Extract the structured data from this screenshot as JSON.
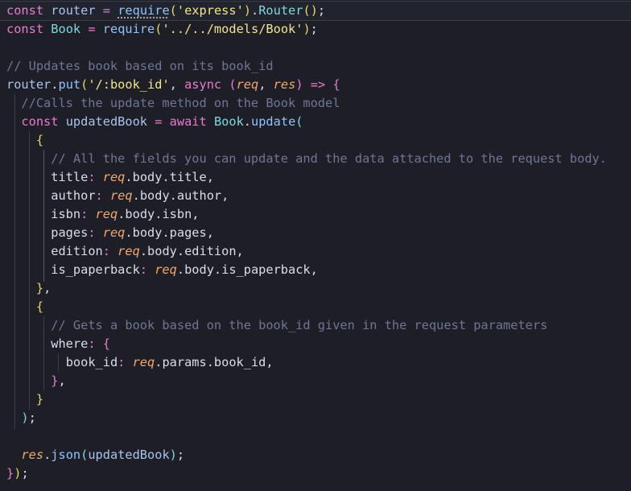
{
  "code": {
    "l1": {
      "kw": "const",
      "name": "router",
      "op": "=",
      "fn": "require",
      "p1": "(",
      "str": "'express'",
      "p2": ")",
      "dot": ".",
      "cls": "Router",
      "p3": "()",
      "semi": ";"
    },
    "l2": {
      "kw": "const",
      "name": "Book",
      "op": "=",
      "fn": "require",
      "p1": "(",
      "str": "'../../models/Book'",
      "p2": ")",
      "semi": ";"
    },
    "l4": {
      "comment": "// Updates book based on its book_id"
    },
    "l5": {
      "obj": "router",
      "dot": ".",
      "fn": "put",
      "p1": "(",
      "str": "'/:book_id'",
      "comma": ",",
      "kw": "async",
      "pa": "(",
      "a1": "req",
      "c": ",",
      "a2": "res",
      "pb": ")",
      "arrow": "=>",
      "brace": "{"
    },
    "l6": {
      "comment": "//Calls the update method on the Book model"
    },
    "l7": {
      "kw": "const",
      "name": "updatedBook",
      "op": "=",
      "aw": "await",
      "cls": "Book",
      "dot": ".",
      "fn": "update",
      "p": "("
    },
    "l8": {
      "brace": "{"
    },
    "l9": {
      "comment": "// All the fields you can update and the data attached to the request body."
    },
    "l10": {
      "key": "title",
      "colon": ":",
      "req": "req",
      "rest": ".body.title",
      "comma": ","
    },
    "l11": {
      "key": "author",
      "colon": ":",
      "req": "req",
      "rest": ".body.author",
      "comma": ","
    },
    "l12": {
      "key": "isbn",
      "colon": ":",
      "req": "req",
      "rest": ".body.isbn",
      "comma": ","
    },
    "l13": {
      "key": "pages",
      "colon": ":",
      "req": "req",
      "rest": ".body.pages",
      "comma": ","
    },
    "l14": {
      "key": "edition",
      "colon": ":",
      "req": "req",
      "rest": ".body.edition",
      "comma": ","
    },
    "l15": {
      "key": "is_paperback",
      "colon": ":",
      "req": "req",
      "rest": ".body.is_paperback",
      "comma": ","
    },
    "l16": {
      "brace": "}",
      "comma": ","
    },
    "l17": {
      "brace": "{"
    },
    "l18": {
      "comment": "// Gets a book based on the book_id given in the request parameters"
    },
    "l19": {
      "key": "where",
      "colon": ":",
      "brace": "{"
    },
    "l20": {
      "key": "book_id",
      "colon": ":",
      "req": "req",
      "rest": ".params.book_id",
      "comma": ","
    },
    "l21": {
      "brace": "}",
      "comma": ","
    },
    "l22": {
      "brace": "}"
    },
    "l23": {
      "paren": ")",
      "semi": ";"
    },
    "l25": {
      "obj": "res",
      "dot": ".",
      "fn": "json",
      "p1": "(",
      "arg": "updatedBook",
      "p2": ")",
      "semi": ";"
    },
    "l26": {
      "brace": "}",
      "paren": ")",
      "semi": ";"
    }
  },
  "colors": {
    "background": "#1e1f26",
    "keyword": "#e97bd0",
    "function": "#8ec3ff",
    "class": "#7ed8e0",
    "string": "#f3e48f",
    "parameter": "#f6a76b",
    "comment": "#6e7696"
  }
}
